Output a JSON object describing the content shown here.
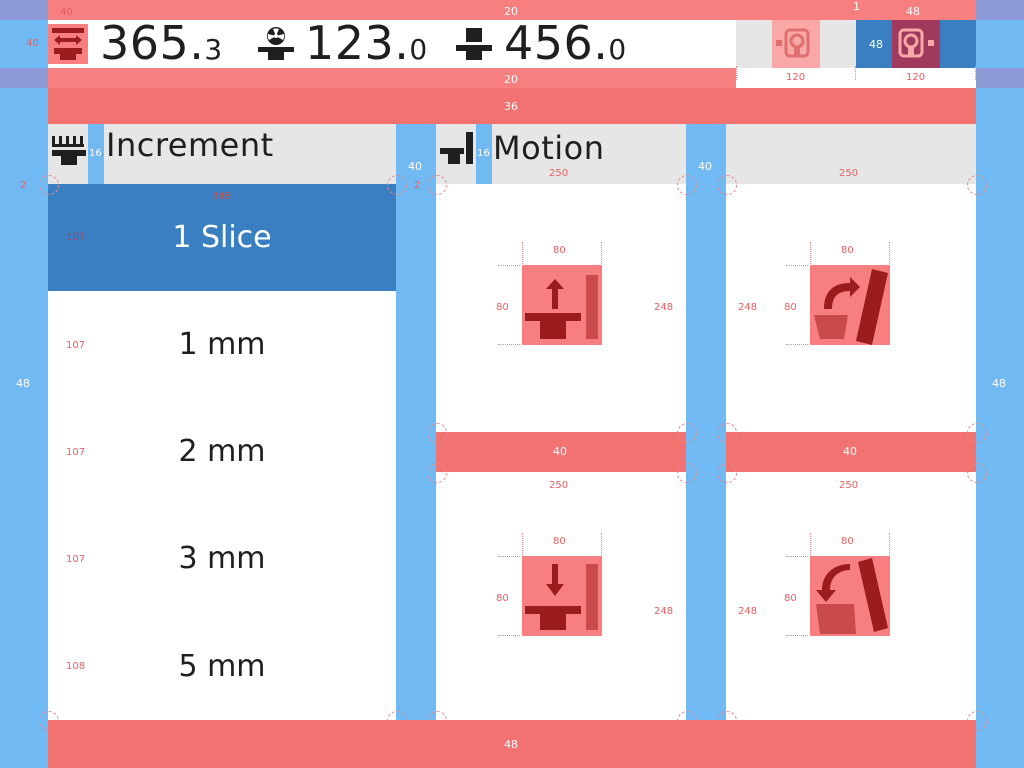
{
  "status_bar": {
    "position_value": "365.",
    "position_decimal": "3",
    "dose_value": "123.",
    "dose_decimal": "0",
    "height_value": "456.",
    "height_decimal": "0",
    "icons": [
      "table-longitudinal-icon",
      "radiation-icon",
      "table-height-icon",
      "gantry-icon",
      "gantry-active-icon"
    ]
  },
  "increment_panel": {
    "title": "Increment",
    "items": [
      {
        "label": "1 Slice",
        "selected": true
      },
      {
        "label": "1 mm",
        "selected": false
      },
      {
        "label": "2 mm",
        "selected": false
      },
      {
        "label": "3 mm",
        "selected": false
      },
      {
        "label": "5 mm",
        "selected": false
      }
    ]
  },
  "motion_panel": {
    "title": "Motion",
    "buttons": [
      "table-up-icon",
      "tilt-forward-icon",
      "table-down-icon",
      "tilt-backward-icon"
    ]
  },
  "annotations": {
    "top_a": "40",
    "top_b": "20",
    "top_c": "48",
    "left_a": "40",
    "gap_20": "20",
    "w120a": "120",
    "w120b": "120",
    "h48": "48",
    "h36": "36",
    "g16a": "16",
    "g16b": "16",
    "g40a": "40",
    "g40b": "40",
    "side48l": "48",
    "side48r": "48",
    "w348": "348",
    "w250a": "250",
    "w250b": "250",
    "w250c": "250",
    "w250d": "250",
    "h80a": "80",
    "h80b": "80",
    "h80c": "80",
    "h80d": "80",
    "w80a": "80",
    "w80b": "80",
    "w80c": "80",
    "w80d": "80",
    "h248a": "248",
    "h248b": "248",
    "h248c": "248",
    "h248d": "248",
    "row107a": "107",
    "row107b": "107",
    "row107c": "107",
    "row107d": "107",
    "row108": "108",
    "mid40a": "40",
    "mid40b": "40",
    "bottom48": "48",
    "two_a": "2",
    "two_b": "2",
    "one": "1"
  },
  "colors": {
    "accent": "#3a7fc1",
    "spacing_red": "#f77f80",
    "spacing_blue": "#70b9f3",
    "icon_dark": "#9b1c1c"
  }
}
